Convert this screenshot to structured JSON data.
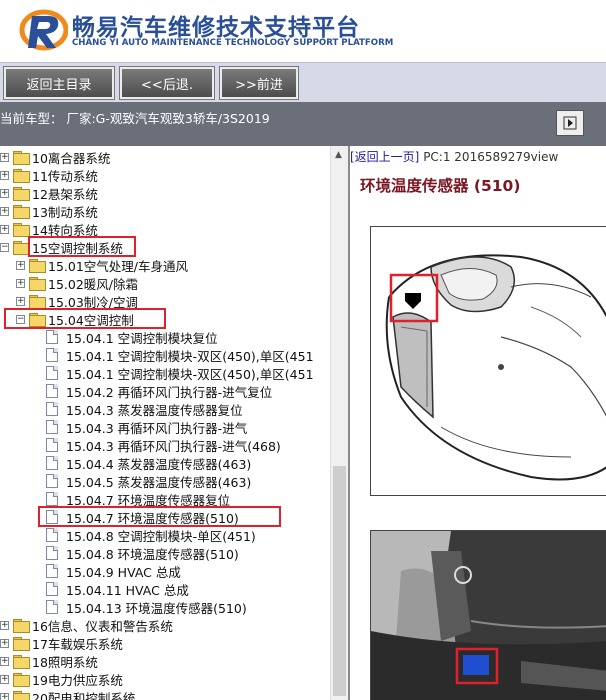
{
  "header": {
    "title_cn": "畅易汽车维修技术支持平台",
    "title_en": "CHANG YI AUTO MAINTENANCE TECHNOLOGY SUPPORT PLATFORM"
  },
  "toolbar": {
    "home_label": "返回主目录",
    "back_label": "<<后退.",
    "forward_label": ">>前进"
  },
  "vehicle": {
    "text": "当前车型：  厂家:G-观致汽车观致3轿车/3S2019"
  },
  "tree": {
    "items": [
      {
        "label": "10离合器系统"
      },
      {
        "label": "11传动系统"
      },
      {
        "label": "12悬架系统"
      },
      {
        "label": "13制动系统"
      },
      {
        "label": "14转向系统"
      },
      {
        "label": "15空调控制系统"
      },
      {
        "label": "15.01空气处理/车身通风"
      },
      {
        "label": "15.02暖风/除霜"
      },
      {
        "label": "15.03制冷/空调"
      },
      {
        "label": "15.04空调控制"
      },
      {
        "label": "15.04.1 空调控制模块复位"
      },
      {
        "label": "15.04.1 空调控制模块-双区(450),单区(451"
      },
      {
        "label": "15.04.1 空调控制模块-双区(450),单区(451"
      },
      {
        "label": "15.04.2 再循环风门执行器-进气复位"
      },
      {
        "label": "15.04.3 蒸发器温度传感器复位"
      },
      {
        "label": "15.04.3 再循环风门执行器-进气"
      },
      {
        "label": "15.04.3 再循环风门执行器-进气(468)"
      },
      {
        "label": "15.04.4 蒸发器温度传感器(463)"
      },
      {
        "label": "15.04.5 蒸发器温度传感器(463)"
      },
      {
        "label": "15.04.7 环境温度传感器复位"
      },
      {
        "label": "15.04.7 环境温度传感器(510)"
      },
      {
        "label": "15.04.8 空调控制模块-单区(451)"
      },
      {
        "label": "15.04.8 环境温度传感器(510)"
      },
      {
        "label": "15.04.9 HVAC 总成"
      },
      {
        "label": "15.04.11 HVAC 总成"
      },
      {
        "label": "15.04.13 环境温度传感器(510)"
      },
      {
        "label": "16信息、仪表和警告系统"
      },
      {
        "label": "17车载娱乐系统"
      },
      {
        "label": "18照明系统"
      },
      {
        "label": "19电力供应系统"
      },
      {
        "label": "20配电和控制系统"
      }
    ]
  },
  "content": {
    "back_link": "[返回上一页]",
    "info": " PC:1 2016589279view",
    "title": "环境温度传感器 (510)"
  },
  "colors": {
    "brand_blue": "#2a4f98",
    "highlight_red": "#e0202a",
    "title_maroon": "#7b1622"
  }
}
